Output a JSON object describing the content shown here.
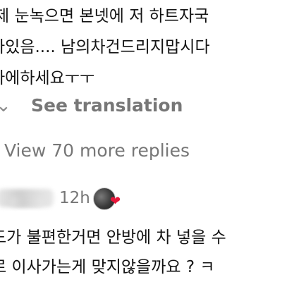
{
  "comment": {
    "lines": [
      "제 눈녹으면 본넷에 저 하트자국",
      "나있음.... 남의차건드리지맙시다",
      "라에하세요ㅜㅜ"
    ],
    "see_translation": "See translation",
    "view_more_replies": "View 70 more replies"
  },
  "reply": {
    "timestamp": "12h",
    "reaction": "heart",
    "lines": [
      "드가 불편한거면 안방에 차 넣을 수",
      "로 이사가는게 맞지않을까요 ? ㅋ"
    ]
  },
  "icons": {
    "translate_chevron": "chevron-icon",
    "heart": "heart-icon"
  },
  "colors": {
    "text": "#141414",
    "muted": "#777777",
    "heart": "#e8173b"
  }
}
